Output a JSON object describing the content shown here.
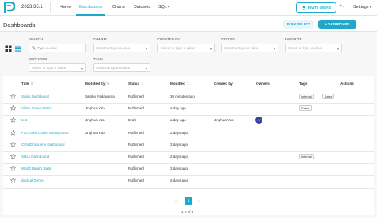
{
  "brand": {
    "version": "2023.35.1",
    "accent": "#20a7c9"
  },
  "nav": {
    "items": [
      {
        "label": "Home",
        "active": false
      },
      {
        "label": "Dashboards",
        "active": true
      },
      {
        "label": "Charts",
        "active": false
      },
      {
        "label": "Datasets",
        "active": false
      },
      {
        "label": "SQL",
        "active": false
      }
    ],
    "invite_label": "INVITE USERS",
    "plus_label": "+",
    "settings_label": "Settings"
  },
  "page": {
    "title": "Dashboards",
    "bulk_select_label": "BULK SELECT",
    "new_dashboard_label": "DASHBOARD",
    "new_dashboard_prefix": "+"
  },
  "filters": {
    "search": {
      "label": "SEARCH",
      "placeholder": "Type a value"
    },
    "owner": {
      "label": "OWNER",
      "placeholder": "Select or type a value"
    },
    "created_by": {
      "label": "CREATED BY",
      "placeholder": "Select or type a value"
    },
    "status": {
      "label": "STATUS",
      "placeholder": "Select or type a value"
    },
    "favorite": {
      "label": "FAVORITE",
      "placeholder": "Select or type a value"
    },
    "certified": {
      "label": "CERTIFIED",
      "placeholder": "Select or type a value"
    },
    "tags": {
      "label": "TAGS",
      "placeholder": "Select or type a value"
    }
  },
  "table": {
    "columns": {
      "title": "Title",
      "modified_by": "Modified by",
      "status": "Status",
      "modified": "Modified",
      "created_by": "Created by",
      "owners": "Owners",
      "tags": "Tags",
      "actions": "Actions"
    },
    "rows": [
      {
        "title": "Sales Dashboard",
        "modified_by": "Satoko Nakayama",
        "status": "Published",
        "modified": "30 minutes ago",
        "created_by": "",
        "owner_initials": "",
        "tags": [
          "Internal",
          "Sales"
        ]
      },
      {
        "title": "Video Game Sales",
        "modified_by": "Jinghua Yao",
        "status": "Published",
        "modified": "a day ago",
        "created_by": "",
        "owner_initials": "",
        "tags": [
          "Sales"
        ]
      },
      {
        "title": "test",
        "modified_by": "Jinghua Yao",
        "status": "Draft",
        "modified": "a day ago",
        "created_by": "Jinghua Yao",
        "owner_initials": "JY",
        "tags": []
      },
      {
        "title": "FCC New Coder Survey 2018",
        "modified_by": "Jinghua Yao",
        "status": "Published",
        "modified": "2 days ago",
        "created_by": "",
        "owner_initials": "",
        "tags": []
      },
      {
        "title": "COVID Vaccine Dashboard",
        "modified_by": "",
        "status": "Published",
        "modified": "2 days ago",
        "created_by": "",
        "owner_initials": "",
        "tags": []
      },
      {
        "title": "Slack Dashboard",
        "modified_by": "",
        "status": "Published",
        "modified": "2 days ago",
        "created_by": "",
        "owner_initials": "",
        "tags": [
          "Internal"
        ]
      },
      {
        "title": "World Bank's Data",
        "modified_by": "",
        "status": "Published",
        "modified": "2 days ago",
        "created_by": "",
        "owner_initials": "",
        "tags": []
      },
      {
        "title": "deck.gl Demo",
        "modified_by": "",
        "status": "Published",
        "modified": "2 days ago",
        "created_by": "",
        "owner_initials": "",
        "tags": []
      }
    ]
  },
  "pagination": {
    "prev_first": "«",
    "prev": "‹",
    "current": "1",
    "next": "›",
    "next_last": "»",
    "count": "1-8 of 8"
  }
}
